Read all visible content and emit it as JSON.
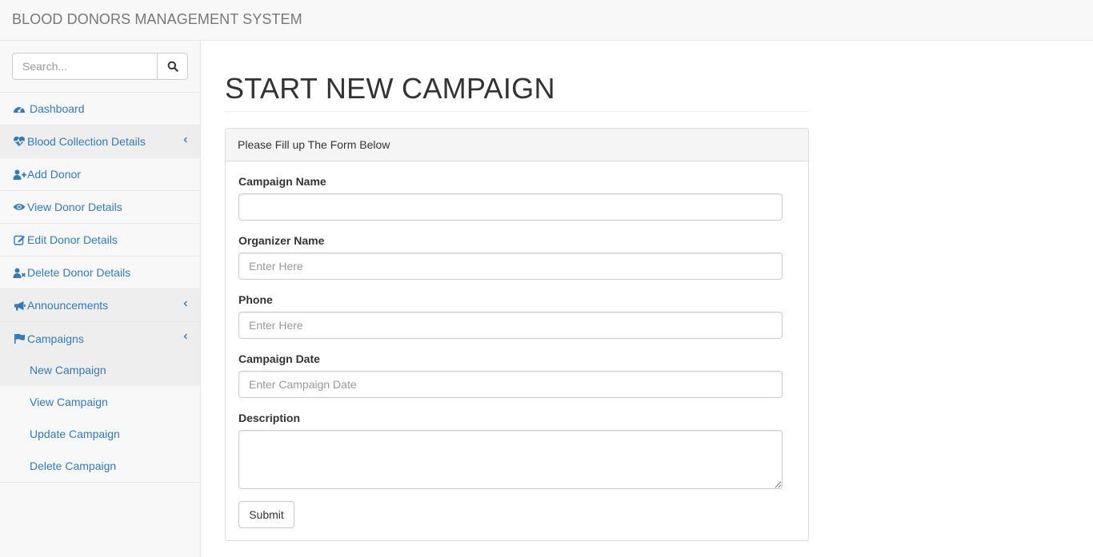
{
  "header": {
    "title": "BLOOD DONORS MANAGEMENT SYSTEM"
  },
  "search": {
    "placeholder": "Search...",
    "icon": "search-icon"
  },
  "sidebar": {
    "items": [
      {
        "label": "Dashboard",
        "icon": "dashboard-icon"
      },
      {
        "label": "Blood Collection Details",
        "icon": "heartbeat-icon",
        "has_submenu": true
      },
      {
        "label": "Add Donor",
        "icon": "user-plus-icon"
      },
      {
        "label": "View Donor Details",
        "icon": "eye-icon"
      },
      {
        "label": "Edit Donor Details",
        "icon": "edit-icon"
      },
      {
        "label": "Delete Donor Details",
        "icon": "user-times-icon"
      },
      {
        "label": "Announcements",
        "icon": "bullhorn-icon",
        "has_submenu": true
      },
      {
        "label": "Campaigns",
        "icon": "flag-icon",
        "has_submenu": true,
        "expanded": true
      }
    ],
    "campaign_subitems": [
      {
        "label": "New Campaign",
        "active": true
      },
      {
        "label": "View Campaign"
      },
      {
        "label": "Update Campaign"
      },
      {
        "label": "Delete Campaign"
      }
    ]
  },
  "main": {
    "page_title": "START NEW CAMPAIGN",
    "panel_heading": "Please Fill up The Form Below",
    "fields": [
      {
        "label": "Campaign Name",
        "placeholder": "",
        "value": ""
      },
      {
        "label": "Organizer Name",
        "placeholder": "Enter Here",
        "value": ""
      },
      {
        "label": "Phone",
        "placeholder": "Enter Here",
        "value": ""
      },
      {
        "label": "Campaign Date",
        "placeholder": "Enter Campaign Date",
        "value": ""
      }
    ],
    "description": {
      "label": "Description",
      "value": ""
    },
    "submit_label": "Submit"
  },
  "colors": {
    "link": "#337ab7",
    "topbar_bg": "#f8f8f8",
    "border": "#e7e7e7",
    "active_bg": "#eeeeee"
  }
}
